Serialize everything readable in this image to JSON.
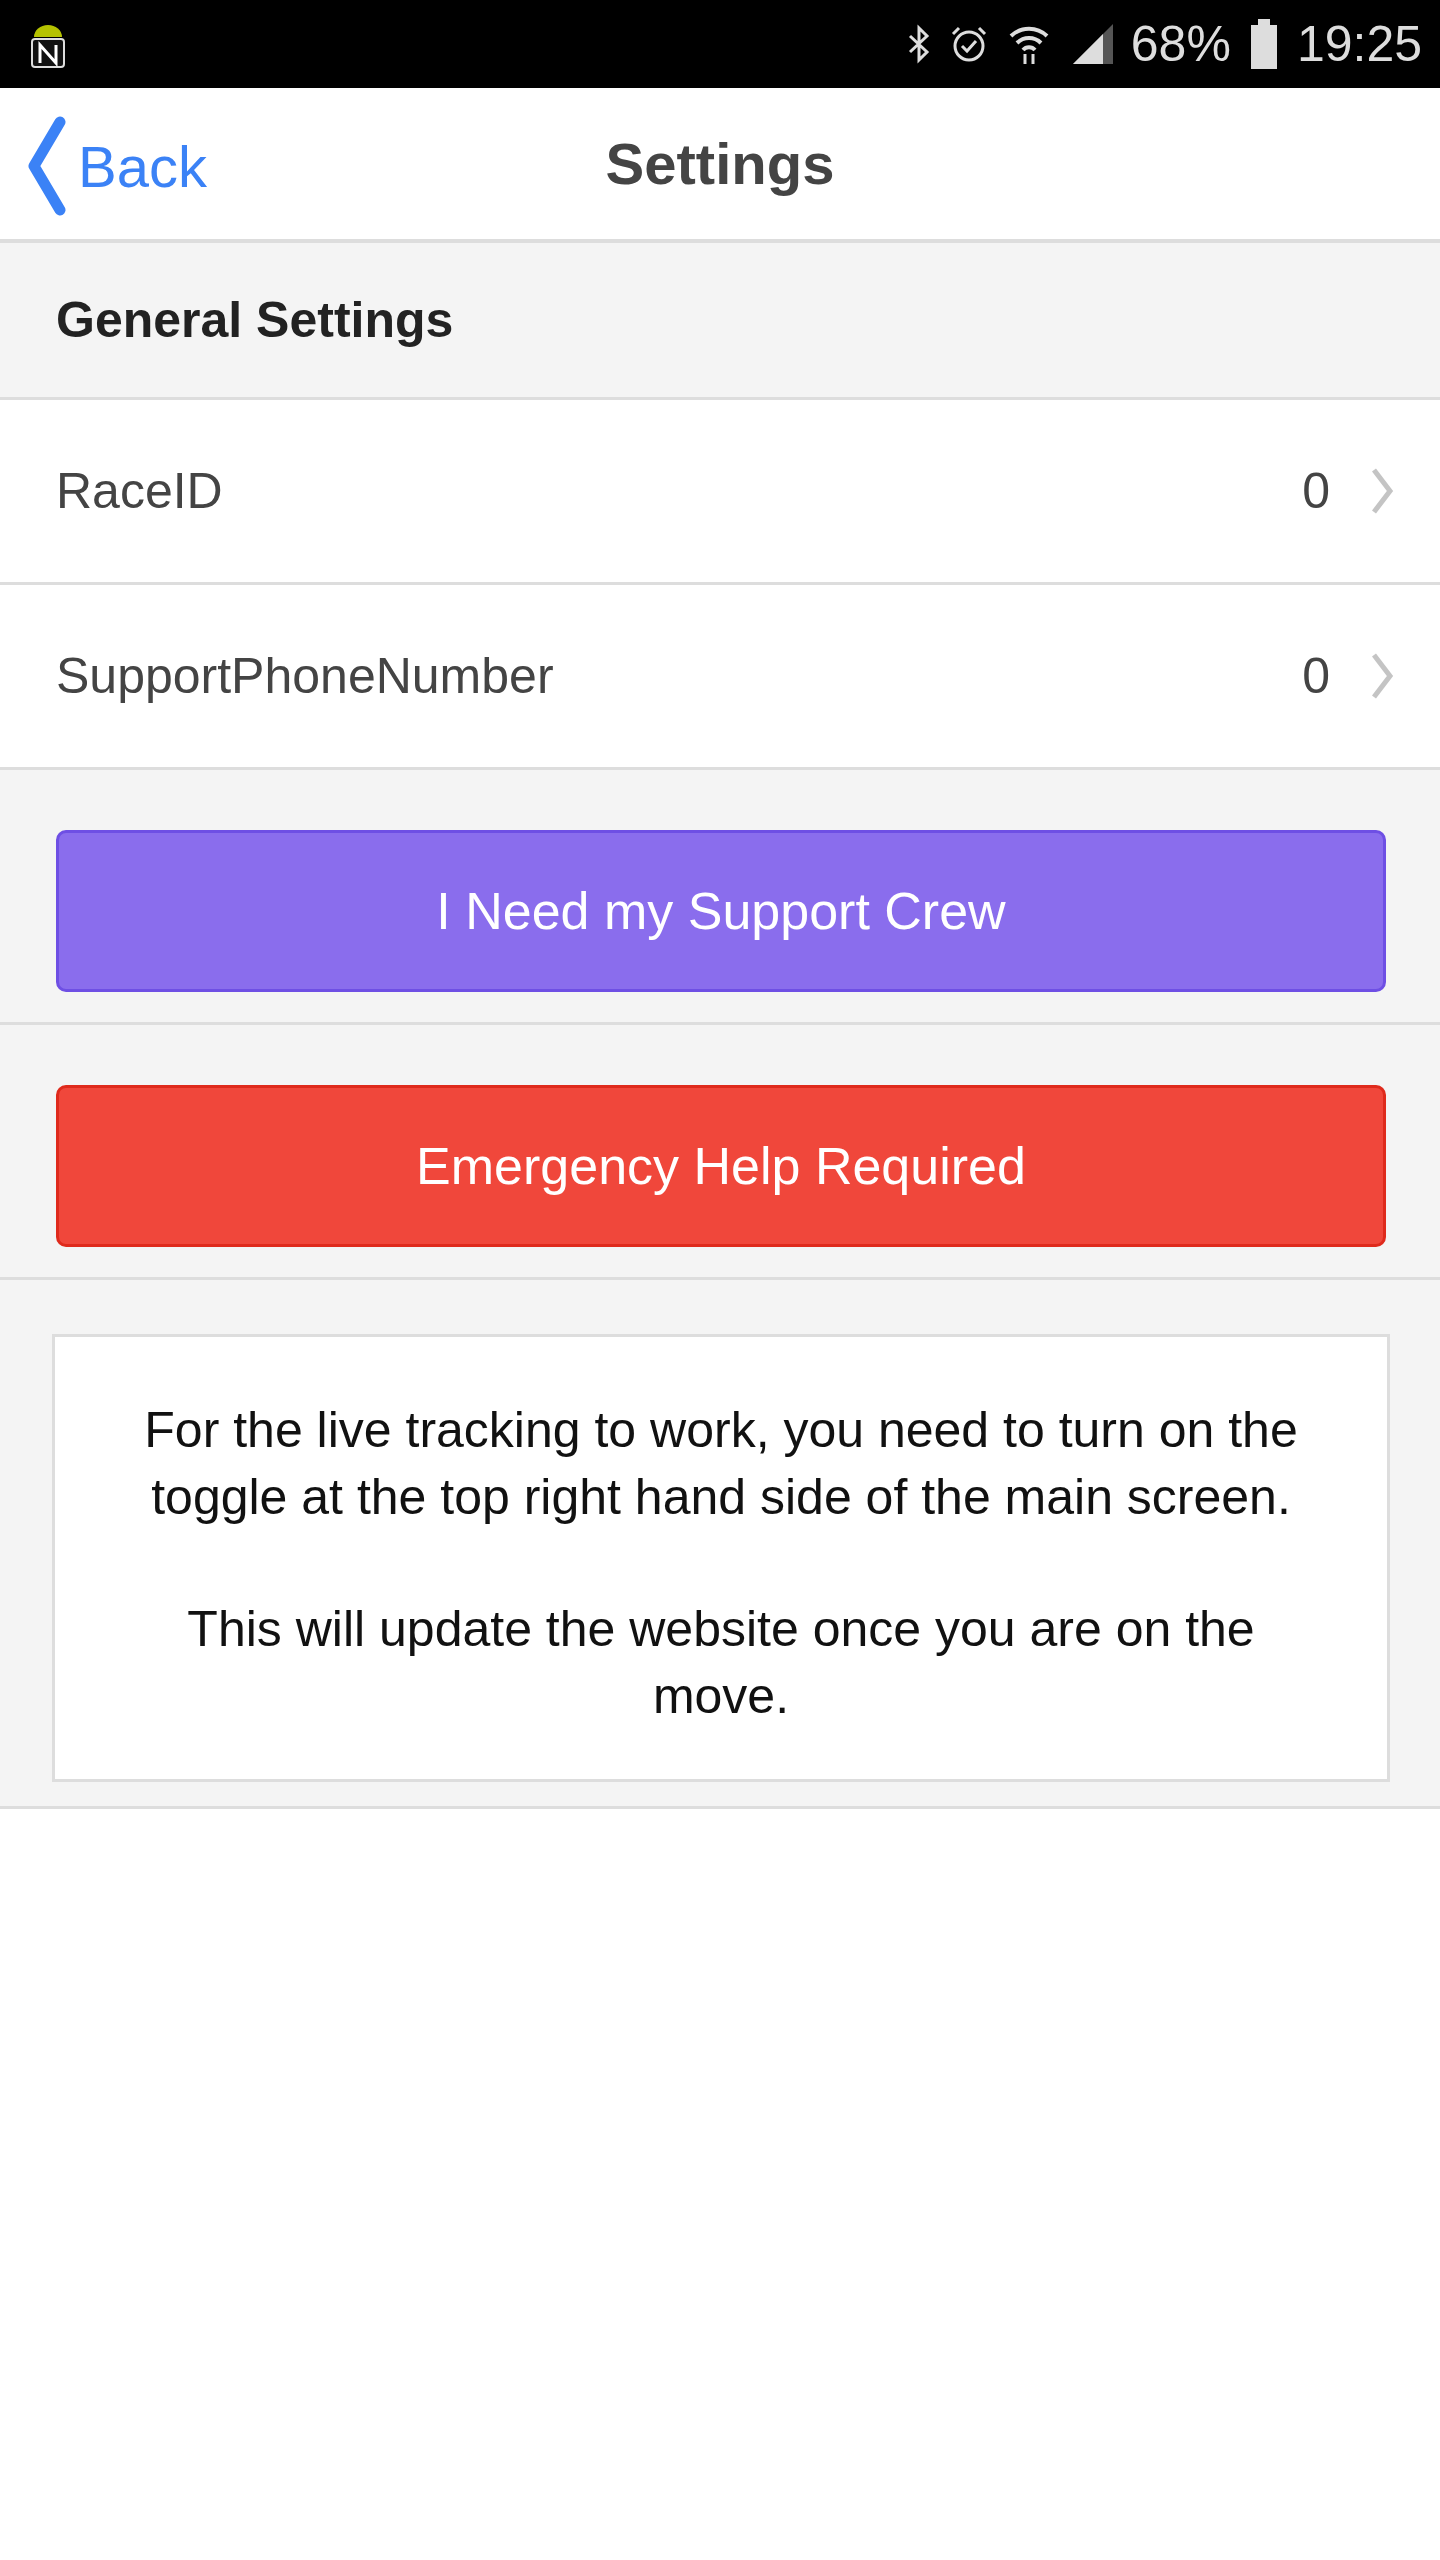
{
  "status_bar": {
    "battery": "68%",
    "time": "19:25"
  },
  "nav_bar": {
    "back": "Back",
    "title": "Settings"
  },
  "section": {
    "title": "General Settings"
  },
  "rows": [
    {
      "label": "RaceID",
      "value": "0"
    },
    {
      "label": "SupportPhoneNumber",
      "value": "0"
    }
  ],
  "buttons": [
    {
      "label": "I Need my Support Crew",
      "kind": "support"
    },
    {
      "label": "Emergency Help Required",
      "kind": "emergency"
    }
  ],
  "message": [
    "For the live tracking to work, you need to turn on the toggle at the top right hand side of the main screen.",
    "This will update the website once you are on the move."
  ]
}
